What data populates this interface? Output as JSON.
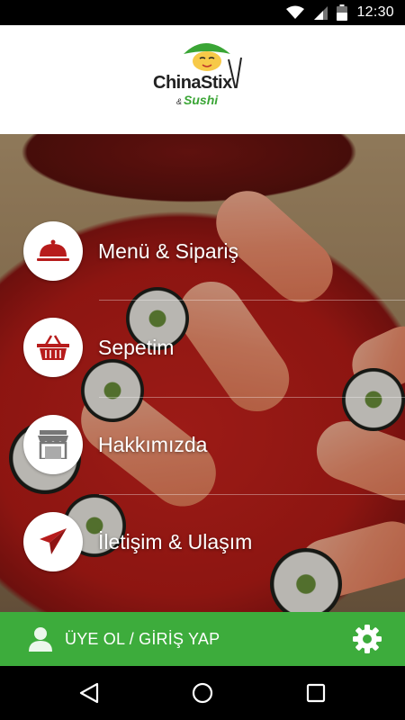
{
  "status_bar": {
    "time": "12:30",
    "icons": [
      "wifi-icon",
      "signal-icon",
      "battery-icon"
    ]
  },
  "header": {
    "logo_text": "ChinaStix",
    "logo_sub": "Sushi",
    "logo_amp": "&"
  },
  "menu": {
    "items": [
      {
        "label": "Menü & Sipariş",
        "icon": "cloche-icon"
      },
      {
        "label": "Sepetim",
        "icon": "basket-icon"
      },
      {
        "label": "Hakkımızda",
        "icon": "store-icon"
      },
      {
        "label": "İletişim & Ulaşım",
        "icon": "paper-plane-icon"
      }
    ],
    "icon_color": "#b71c1c"
  },
  "bottom_bar": {
    "login_label": "ÜYE OL / GİRİŞ YAP",
    "color": "#3dac3c",
    "icons": [
      "user-icon",
      "gear-icon"
    ]
  },
  "nav_bar": {
    "icons": [
      "back-icon",
      "home-icon",
      "recents-icon"
    ]
  }
}
